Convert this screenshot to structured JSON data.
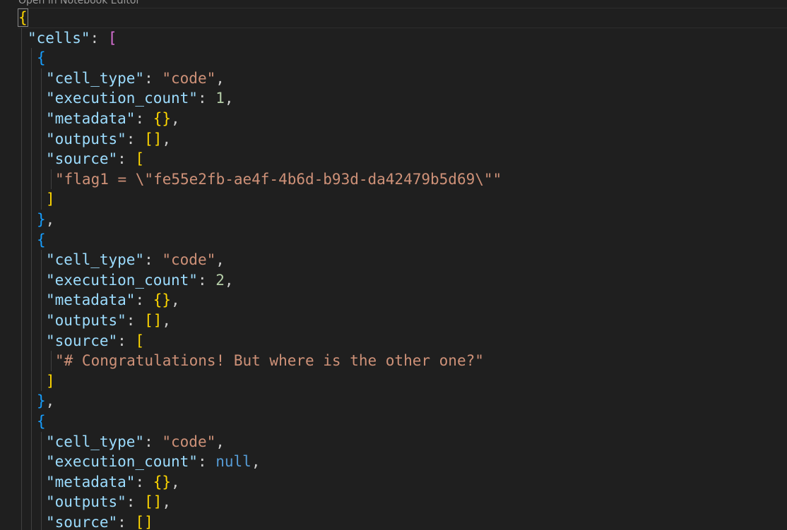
{
  "codelens": "Open in Notebook Editor",
  "colors": {
    "background": "#1f1f1f",
    "key": "#9cdcfe",
    "string": "#ce9178",
    "number": "#b5cea8",
    "keyword": "#569cd6",
    "punctuation": "#cccccc",
    "bracket_level_1": "#ffd700",
    "bracket_level_2": "#da70d6",
    "bracket_level_3": "#179fff"
  },
  "lines": [
    {
      "indent": 0,
      "current": true,
      "tokens": [
        {
          "t": "{",
          "c": "b1",
          "m": true
        }
      ]
    },
    {
      "indent": 1,
      "tokens": [
        {
          "t": "\"cells\"",
          "c": "k"
        },
        {
          "t": ": ",
          "c": "p"
        },
        {
          "t": "[",
          "c": "b2"
        }
      ]
    },
    {
      "indent": 2,
      "tokens": [
        {
          "t": "{",
          "c": "b3"
        }
      ]
    },
    {
      "indent": 3,
      "tokens": [
        {
          "t": "\"cell_type\"",
          "c": "k"
        },
        {
          "t": ": ",
          "c": "p"
        },
        {
          "t": "\"code\"",
          "c": "s"
        },
        {
          "t": ",",
          "c": "p"
        }
      ]
    },
    {
      "indent": 3,
      "tokens": [
        {
          "t": "\"execution_count\"",
          "c": "k"
        },
        {
          "t": ": ",
          "c": "p"
        },
        {
          "t": "1",
          "c": "n"
        },
        {
          "t": ",",
          "c": "p"
        }
      ]
    },
    {
      "indent": 3,
      "tokens": [
        {
          "t": "\"metadata\"",
          "c": "k"
        },
        {
          "t": ": ",
          "c": "p"
        },
        {
          "t": "{}",
          "c": "b1"
        },
        {
          "t": ",",
          "c": "p"
        }
      ]
    },
    {
      "indent": 3,
      "tokens": [
        {
          "t": "\"outputs\"",
          "c": "k"
        },
        {
          "t": ": ",
          "c": "p"
        },
        {
          "t": "[]",
          "c": "b1"
        },
        {
          "t": ",",
          "c": "p"
        }
      ]
    },
    {
      "indent": 3,
      "tokens": [
        {
          "t": "\"source\"",
          "c": "k"
        },
        {
          "t": ": ",
          "c": "p"
        },
        {
          "t": "[",
          "c": "b1"
        }
      ]
    },
    {
      "indent": 4,
      "tokens": [
        {
          "t": "\"flag1 = \\\"fe55e2fb-ae4f-4b6d-b93d-da42479b5d69\\\"\"",
          "c": "s"
        }
      ]
    },
    {
      "indent": 3,
      "tokens": [
        {
          "t": "]",
          "c": "b1"
        }
      ]
    },
    {
      "indent": 2,
      "tokens": [
        {
          "t": "}",
          "c": "b3"
        },
        {
          "t": ",",
          "c": "p"
        }
      ]
    },
    {
      "indent": 2,
      "tokens": [
        {
          "t": "{",
          "c": "b3"
        }
      ]
    },
    {
      "indent": 3,
      "tokens": [
        {
          "t": "\"cell_type\"",
          "c": "k"
        },
        {
          "t": ": ",
          "c": "p"
        },
        {
          "t": "\"code\"",
          "c": "s"
        },
        {
          "t": ",",
          "c": "p"
        }
      ]
    },
    {
      "indent": 3,
      "tokens": [
        {
          "t": "\"execution_count\"",
          "c": "k"
        },
        {
          "t": ": ",
          "c": "p"
        },
        {
          "t": "2",
          "c": "n"
        },
        {
          "t": ",",
          "c": "p"
        }
      ]
    },
    {
      "indent": 3,
      "tokens": [
        {
          "t": "\"metadata\"",
          "c": "k"
        },
        {
          "t": ": ",
          "c": "p"
        },
        {
          "t": "{}",
          "c": "b1"
        },
        {
          "t": ",",
          "c": "p"
        }
      ]
    },
    {
      "indent": 3,
      "tokens": [
        {
          "t": "\"outputs\"",
          "c": "k"
        },
        {
          "t": ": ",
          "c": "p"
        },
        {
          "t": "[]",
          "c": "b1"
        },
        {
          "t": ",",
          "c": "p"
        }
      ]
    },
    {
      "indent": 3,
      "tokens": [
        {
          "t": "\"source\"",
          "c": "k"
        },
        {
          "t": ": ",
          "c": "p"
        },
        {
          "t": "[",
          "c": "b1"
        }
      ]
    },
    {
      "indent": 4,
      "tokens": [
        {
          "t": "\"# Congratulations! But where is the other one?\"",
          "c": "s"
        }
      ]
    },
    {
      "indent": 3,
      "tokens": [
        {
          "t": "]",
          "c": "b1"
        }
      ]
    },
    {
      "indent": 2,
      "tokens": [
        {
          "t": "}",
          "c": "b3"
        },
        {
          "t": ",",
          "c": "p"
        }
      ]
    },
    {
      "indent": 2,
      "tokens": [
        {
          "t": "{",
          "c": "b3"
        }
      ]
    },
    {
      "indent": 3,
      "tokens": [
        {
          "t": "\"cell_type\"",
          "c": "k"
        },
        {
          "t": ": ",
          "c": "p"
        },
        {
          "t": "\"code\"",
          "c": "s"
        },
        {
          "t": ",",
          "c": "p"
        }
      ]
    },
    {
      "indent": 3,
      "tokens": [
        {
          "t": "\"execution_count\"",
          "c": "k"
        },
        {
          "t": ": ",
          "c": "p"
        },
        {
          "t": "null",
          "c": "kw"
        },
        {
          "t": ",",
          "c": "p"
        }
      ]
    },
    {
      "indent": 3,
      "tokens": [
        {
          "t": "\"metadata\"",
          "c": "k"
        },
        {
          "t": ": ",
          "c": "p"
        },
        {
          "t": "{}",
          "c": "b1"
        },
        {
          "t": ",",
          "c": "p"
        }
      ]
    },
    {
      "indent": 3,
      "tokens": [
        {
          "t": "\"outputs\"",
          "c": "k"
        },
        {
          "t": ": ",
          "c": "p"
        },
        {
          "t": "[]",
          "c": "b1"
        },
        {
          "t": ",",
          "c": "p"
        }
      ]
    },
    {
      "indent": 3,
      "tokens": [
        {
          "t": "\"source\"",
          "c": "k"
        },
        {
          "t": ": ",
          "c": "p"
        },
        {
          "t": "[]",
          "c": "b1"
        }
      ]
    }
  ]
}
